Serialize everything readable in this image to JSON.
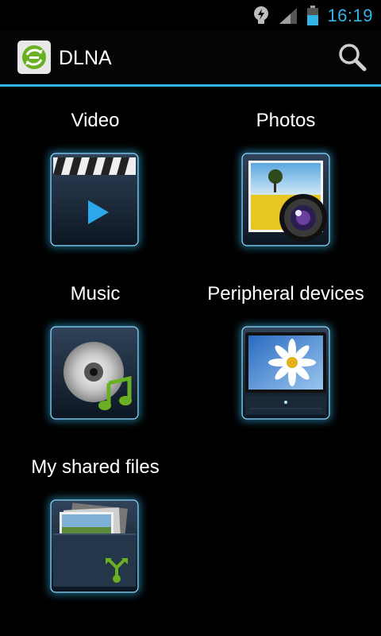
{
  "status_bar": {
    "time": "16:19",
    "icons": [
      "notification-bulb-icon",
      "signal-icon",
      "battery-icon"
    ]
  },
  "action_bar": {
    "title": "DLNA",
    "logo_icon": "dlna-sync-icon",
    "search_icon": "search-icon"
  },
  "colors": {
    "accent": "#33b5e5",
    "background": "#000000"
  },
  "grid": {
    "items": [
      {
        "label": "Video",
        "icon": "video-clapper-icon"
      },
      {
        "label": "Photos",
        "icon": "photo-camera-icon"
      },
      {
        "label": "Music",
        "icon": "music-cd-icon"
      },
      {
        "label": "Peripheral devices",
        "icon": "tv-display-icon"
      },
      {
        "label": "My shared files",
        "icon": "shared-files-folder-icon"
      }
    ]
  }
}
